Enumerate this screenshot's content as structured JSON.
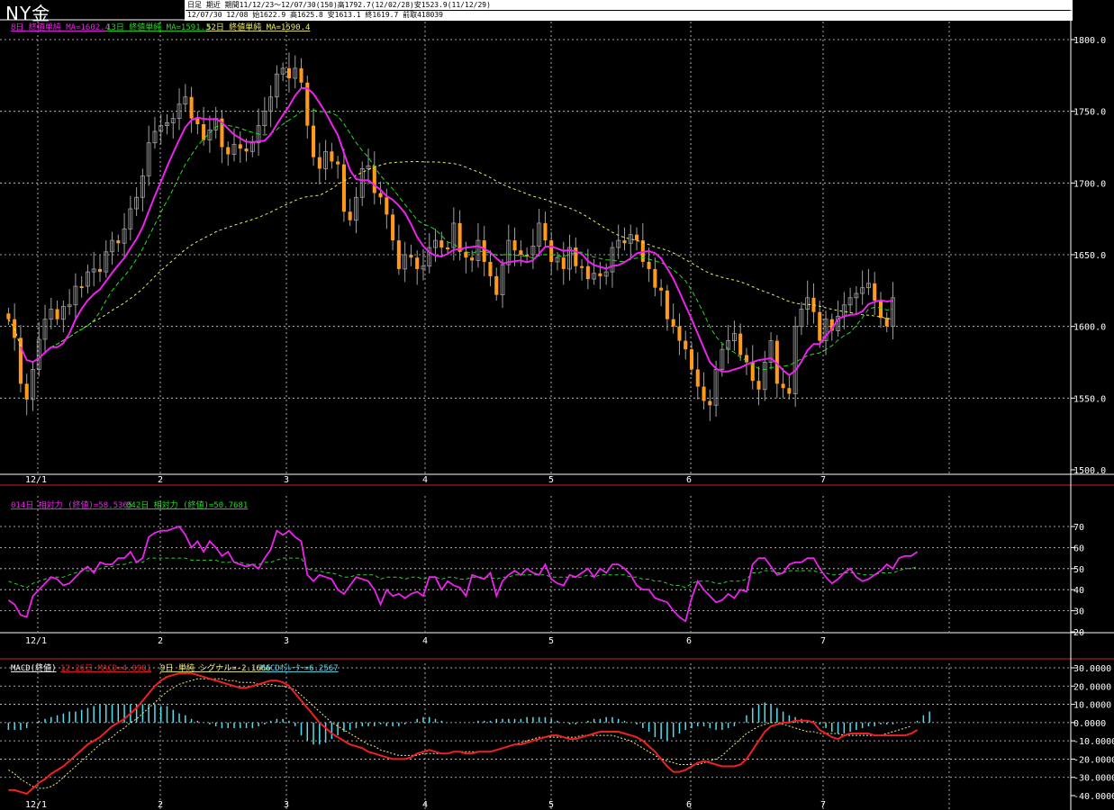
{
  "header": {
    "title": "NY金",
    "info_line1": "日足 期近 期間11/12/23～12/07/30(150)高1792.7(12/02/28)安1523.9(11/12/29)",
    "info_line2": "12/07/30 12/08 始1622.9 高1625.8 安1613.1 終1619.7 前取418039"
  },
  "colors": {
    "ma8": "#ee22ee",
    "ma13": "#22dd22",
    "ma52": "#eeee66",
    "candle": "#ff9a1a",
    "macd": "#ee2222",
    "signal": "#eeee88",
    "osc": "#55ddee",
    "rsi9": "#ee22ee",
    "rsi42": "#33cc33"
  },
  "chart_data": [
    {
      "type": "candlestick",
      "legend": [
        {
          "text": "8日 終値単純 MA=1602.4",
          "color": "#ee22ee"
        },
        {
          "text": "13日 終値単純 MA=1591.3",
          "color": "#22dd22"
        },
        {
          "text": "52日 終値単純 MA=1590.4",
          "color": "#eeee66"
        }
      ],
      "y_ticks": [
        "1800.0",
        "1750.0",
        "1700.0",
        "1650.0",
        "1600.0",
        "1550.0",
        "1500.0"
      ],
      "ylim": [
        1500,
        1800
      ],
      "x_ticks": [
        "12/1",
        "2",
        "3",
        "4",
        "5",
        "6",
        "7"
      ],
      "bar_count": 150,
      "close": [
        1605,
        1592,
        1560,
        1549,
        1570,
        1591,
        1605,
        1612,
        1605,
        1614,
        1615,
        1628,
        1628,
        1638,
        1640,
        1638,
        1652,
        1660,
        1658,
        1668,
        1682,
        1690,
        1705,
        1728,
        1736,
        1740,
        1742,
        1745,
        1755,
        1760,
        1745,
        1741,
        1730,
        1737,
        1745,
        1725,
        1720,
        1727,
        1724,
        1722,
        1728,
        1740,
        1750,
        1760,
        1776,
        1780,
        1773,
        1780,
        1770,
        1740,
        1718,
        1710,
        1722,
        1715,
        1713,
        1680,
        1674,
        1690,
        1710,
        1712,
        1693,
        1690,
        1678,
        1660,
        1640,
        1650,
        1648,
        1640,
        1642,
        1655,
        1660,
        1655,
        1655,
        1672,
        1652,
        1648,
        1646,
        1660,
        1645,
        1635,
        1622,
        1643,
        1660,
        1653,
        1650,
        1650,
        1656,
        1672,
        1660,
        1645,
        1648,
        1640,
        1655,
        1642,
        1642,
        1633,
        1637,
        1635,
        1638,
        1655,
        1660,
        1658,
        1664,
        1660,
        1645,
        1640,
        1627,
        1625,
        1605,
        1600,
        1590,
        1584,
        1570,
        1558,
        1548,
        1545,
        1570,
        1584,
        1590,
        1595,
        1580,
        1575,
        1562,
        1556,
        1575,
        1590,
        1560,
        1557,
        1553,
        1600,
        1612,
        1620,
        1610,
        1590,
        1605,
        1597,
        1607,
        1615,
        1620,
        1623,
        1627,
        1630,
        1618,
        1606,
        1600,
        1620
      ]
    },
    {
      "type": "line",
      "legend": [
        {
          "text": "014日 相対力 (終値)=58.5365",
          "color": "#ee22ee"
        },
        {
          "text": "042日 相対力 (終値)=50.7681",
          "color": "#22dd22"
        }
      ],
      "y_ticks": [
        "70",
        "60",
        "50",
        "40",
        "30",
        "20"
      ],
      "ylim": [
        20,
        70
      ],
      "x_ticks": [
        "12/1",
        "2",
        "3",
        "4",
        "5",
        "6",
        "7"
      ],
      "series": [
        {
          "name": "014日 相対力 (終値)",
          "values": [
            35,
            33,
            28,
            27,
            37,
            40,
            43,
            46,
            45,
            42,
            43,
            46,
            49,
            51,
            48,
            53,
            52,
            52,
            55,
            55,
            58,
            53,
            55,
            65,
            67,
            68,
            68,
            69,
            70,
            66,
            60,
            63,
            58,
            63,
            60,
            56,
            58,
            53,
            52,
            51,
            52,
            50,
            55,
            59,
            68,
            66,
            68,
            65,
            63,
            47,
            44,
            47,
            46,
            45,
            40,
            38,
            42,
            46,
            45,
            44,
            40,
            33,
            40,
            37,
            38,
            36,
            38,
            39,
            37,
            46,
            46,
            40,
            44,
            42,
            41,
            37,
            47,
            46,
            45,
            48,
            37,
            44,
            47,
            49,
            47,
            50,
            48,
            47,
            52,
            45,
            43,
            42,
            47,
            46,
            48,
            50,
            46,
            50,
            48,
            52,
            52,
            50,
            47,
            42,
            40,
            40,
            36,
            35,
            34,
            30,
            27,
            25,
            36,
            44,
            40,
            37,
            34,
            35,
            38,
            36,
            40,
            39,
            52,
            55,
            55,
            51,
            47,
            48,
            52,
            53,
            53,
            55,
            55,
            50,
            46,
            43,
            45,
            48,
            50,
            46,
            44,
            45,
            47,
            49,
            52,
            50,
            55,
            56,
            56,
            58
          ]
        },
        {
          "name": "042日 相対力 (終値)",
          "values": [
            44,
            43,
            42,
            41,
            43,
            44,
            45,
            46,
            46,
            46,
            47,
            48,
            49,
            49,
            49,
            50,
            51,
            51,
            52,
            52,
            53,
            53,
            53,
            55,
            55,
            55,
            55,
            55,
            55,
            55,
            54,
            54,
            54,
            54,
            54,
            53,
            53,
            53,
            53,
            52,
            52,
            52,
            53,
            53,
            54,
            55,
            55,
            55,
            55,
            50,
            49,
            49,
            48,
            48,
            47,
            46,
            46,
            47,
            47,
            47,
            47,
            45,
            46,
            46,
            46,
            45,
            46,
            46,
            45,
            46,
            46,
            45,
            46,
            46,
            45,
            45,
            46,
            46,
            46,
            46,
            45,
            46,
            46,
            47,
            47,
            47,
            47,
            47,
            47,
            46,
            46,
            46,
            46,
            46,
            46,
            47,
            46,
            47,
            47,
            47,
            47,
            47,
            46,
            46,
            45,
            45,
            44,
            44,
            43,
            42,
            42,
            41,
            43,
            44,
            44,
            44,
            43,
            43,
            44,
            44,
            44,
            45,
            48,
            48,
            49,
            49,
            48,
            48,
            49,
            49,
            49,
            49,
            49,
            48,
            48,
            47,
            47,
            48,
            48,
            48,
            47,
            47,
            47,
            48,
            48,
            48,
            49,
            50,
            50,
            51
          ]
        }
      ]
    },
    {
      "type": "line+bar",
      "legend": [
        {
          "text": "MACD(終値)",
          "color": "#ffffff"
        },
        {
          "text": "12-26日 MACD=4.0901",
          "color": "#ee2222"
        },
        {
          "text": "9日 単純 シグナル=-2.1666",
          "color": "#eeee88"
        },
        {
          "text": "MACDｵｼﾚｰﾀｰ=6.2567",
          "color": "#55ddee"
        }
      ],
      "y_ticks": [
        "30.0000",
        "20.0000",
        "10.0000",
        "0.0000",
        "-10.0000",
        "-20.0000",
        "-30.0000",
        "-40.0000"
      ],
      "ylim": [
        -40,
        30
      ],
      "x_ticks": [
        "12/1",
        "2",
        "3",
        "4",
        "5",
        "6",
        "7"
      ],
      "series": [
        {
          "name": "12-26日 MACD",
          "values": [
            -37,
            -37,
            -38,
            -39,
            -36,
            -33,
            -31,
            -28,
            -26,
            -24,
            -21,
            -18,
            -15,
            -12,
            -10,
            -8,
            -5,
            -2,
            0,
            2,
            5,
            8,
            12,
            16,
            20,
            23,
            25,
            26,
            27,
            27,
            27,
            26,
            25,
            24,
            23,
            22,
            21,
            20,
            19,
            19,
            20,
            21,
            22,
            23,
            23,
            22,
            20,
            16,
            12,
            8,
            4,
            0,
            -3,
            -6,
            -8,
            -10,
            -12,
            -13,
            -14,
            -16,
            -17,
            -18,
            -19,
            -20,
            -20,
            -20,
            -19,
            -17,
            -16,
            -15,
            -16,
            -17,
            -17,
            -16,
            -16,
            -17,
            -17,
            -16,
            -16,
            -16,
            -15,
            -14,
            -13,
            -12,
            -12,
            -11,
            -10,
            -9,
            -8,
            -7,
            -7,
            -8,
            -9,
            -9,
            -8,
            -7,
            -6,
            -5,
            -5,
            -5,
            -5,
            -6,
            -7,
            -8,
            -10,
            -13,
            -16,
            -20,
            -24,
            -27,
            -27,
            -26,
            -24,
            -22,
            -21,
            -22,
            -23,
            -24,
            -24,
            -24,
            -23,
            -20,
            -15,
            -10,
            -5,
            -2,
            -1,
            0,
            0,
            1,
            1,
            1,
            0,
            -4,
            -6,
            -8,
            -9,
            -7,
            -6,
            -6,
            -6,
            -6,
            -7,
            -7,
            -7,
            -7,
            -7,
            -7,
            -6,
            -4
          ]
        },
        {
          "name": "9日 単純 シグナル",
          "values": [
            -26,
            -28,
            -31,
            -33,
            -35,
            -36,
            -36,
            -35,
            -33,
            -30,
            -27,
            -24,
            -21,
            -18,
            -15,
            -12,
            -10,
            -8,
            -5,
            -3,
            0,
            2,
            5,
            8,
            11,
            14,
            17,
            19,
            21,
            22,
            23,
            24,
            24,
            24,
            24,
            24,
            23,
            23,
            22,
            22,
            22,
            21,
            21,
            21,
            20,
            20,
            19,
            18,
            15,
            12,
            9,
            6,
            3,
            0,
            -2,
            -4,
            -6,
            -8,
            -10,
            -12,
            -13,
            -15,
            -16,
            -17,
            -18,
            -18,
            -18,
            -18,
            -17,
            -17,
            -17,
            -17,
            -17,
            -16,
            -16,
            -16,
            -16,
            -16,
            -16,
            -16,
            -15,
            -14,
            -13,
            -12,
            -11,
            -10,
            -9,
            -8,
            -8,
            -8,
            -8,
            -8,
            -8,
            -8,
            -7,
            -7,
            -7,
            -7,
            -7,
            -7,
            -8,
            -9,
            -10,
            -12,
            -14,
            -16,
            -18,
            -20,
            -21,
            -22,
            -23,
            -23,
            -23,
            -23,
            -22,
            -21,
            -20,
            -18,
            -15,
            -12,
            -9,
            -6,
            -4,
            -2,
            -1,
            0,
            0,
            -1,
            -2,
            -3,
            -4,
            -5,
            -5,
            -6,
            -6,
            -6,
            -6,
            -7,
            -7,
            -7,
            -7,
            -7,
            -7,
            -7,
            -6,
            -5,
            -4,
            -3,
            -2
          ]
        },
        {
          "name": "MACDｵｼﾚｰﾀｰ",
          "values": [
            -4,
            -4,
            -4,
            -3,
            0,
            1,
            2,
            3,
            4,
            5,
            6,
            6,
            7,
            8,
            9,
            10,
            10,
            10,
            10,
            10,
            10,
            10,
            10,
            10,
            10,
            9,
            9,
            7,
            5,
            4,
            2,
            1,
            0,
            -1,
            -2,
            -3,
            -3,
            -3,
            -3,
            -3,
            -3,
            -2,
            -1,
            1,
            2,
            2,
            1,
            -2,
            -7,
            -10,
            -12,
            -12,
            -11,
            -9,
            -7,
            -5,
            -4,
            -3,
            -2,
            -2,
            -2,
            -1,
            -2,
            -2,
            -2,
            -1,
            0,
            2,
            3,
            3,
            2,
            1,
            0,
            0,
            0,
            0,
            0,
            1,
            1,
            1,
            2,
            2,
            2,
            2,
            2,
            3,
            3,
            3,
            3,
            2,
            1,
            0,
            -1,
            -1,
            0,
            1,
            2,
            2,
            3,
            3,
            2,
            1,
            0,
            -1,
            -3,
            -5,
            -8,
            -9,
            -10,
            -8,
            -6,
            -4,
            -3,
            -2,
            -2,
            -3,
            -4,
            -4,
            -3,
            -2,
            0,
            4,
            8,
            10,
            11,
            10,
            8,
            6,
            4,
            3,
            2,
            1,
            1,
            -1,
            -3,
            -5,
            -6,
            -6,
            -5,
            -4,
            -3,
            -2,
            -2,
            -1,
            -1,
            -1,
            0,
            0,
            0,
            1,
            4,
            6
          ]
        }
      ]
    }
  ]
}
